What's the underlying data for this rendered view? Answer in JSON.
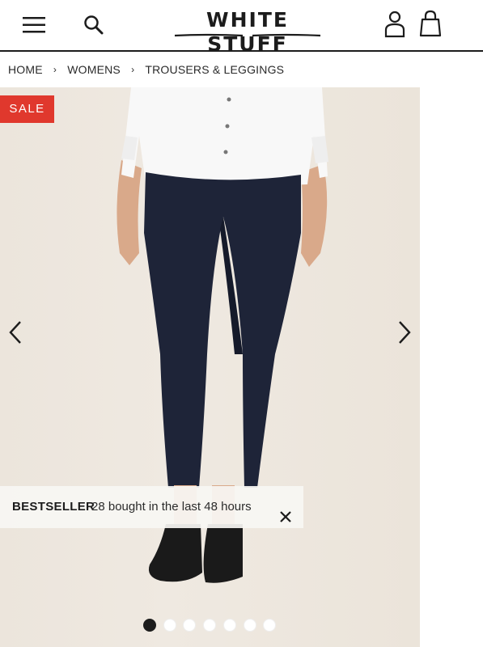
{
  "header": {
    "logo_text": "WHITE STUFF",
    "icons": [
      "menu-icon",
      "search-icon",
      "account-icon",
      "bag-icon"
    ]
  },
  "breadcrumb": {
    "items": [
      "HOME",
      "WOMENS",
      "TROUSERS & LEGGINGS"
    ],
    "separator": "›"
  },
  "gallery": {
    "sale_badge": "SALE",
    "bestseller_tag": "BESTSELLER",
    "bestseller_message": "28 bought in the last 48 hours",
    "close_symbol": "X",
    "slide_count": 7,
    "active_slide": 1
  },
  "colors": {
    "sale_red": "#e0382d",
    "navy_trouser": "#1e2438",
    "text_dark": "#1c1c1c"
  }
}
